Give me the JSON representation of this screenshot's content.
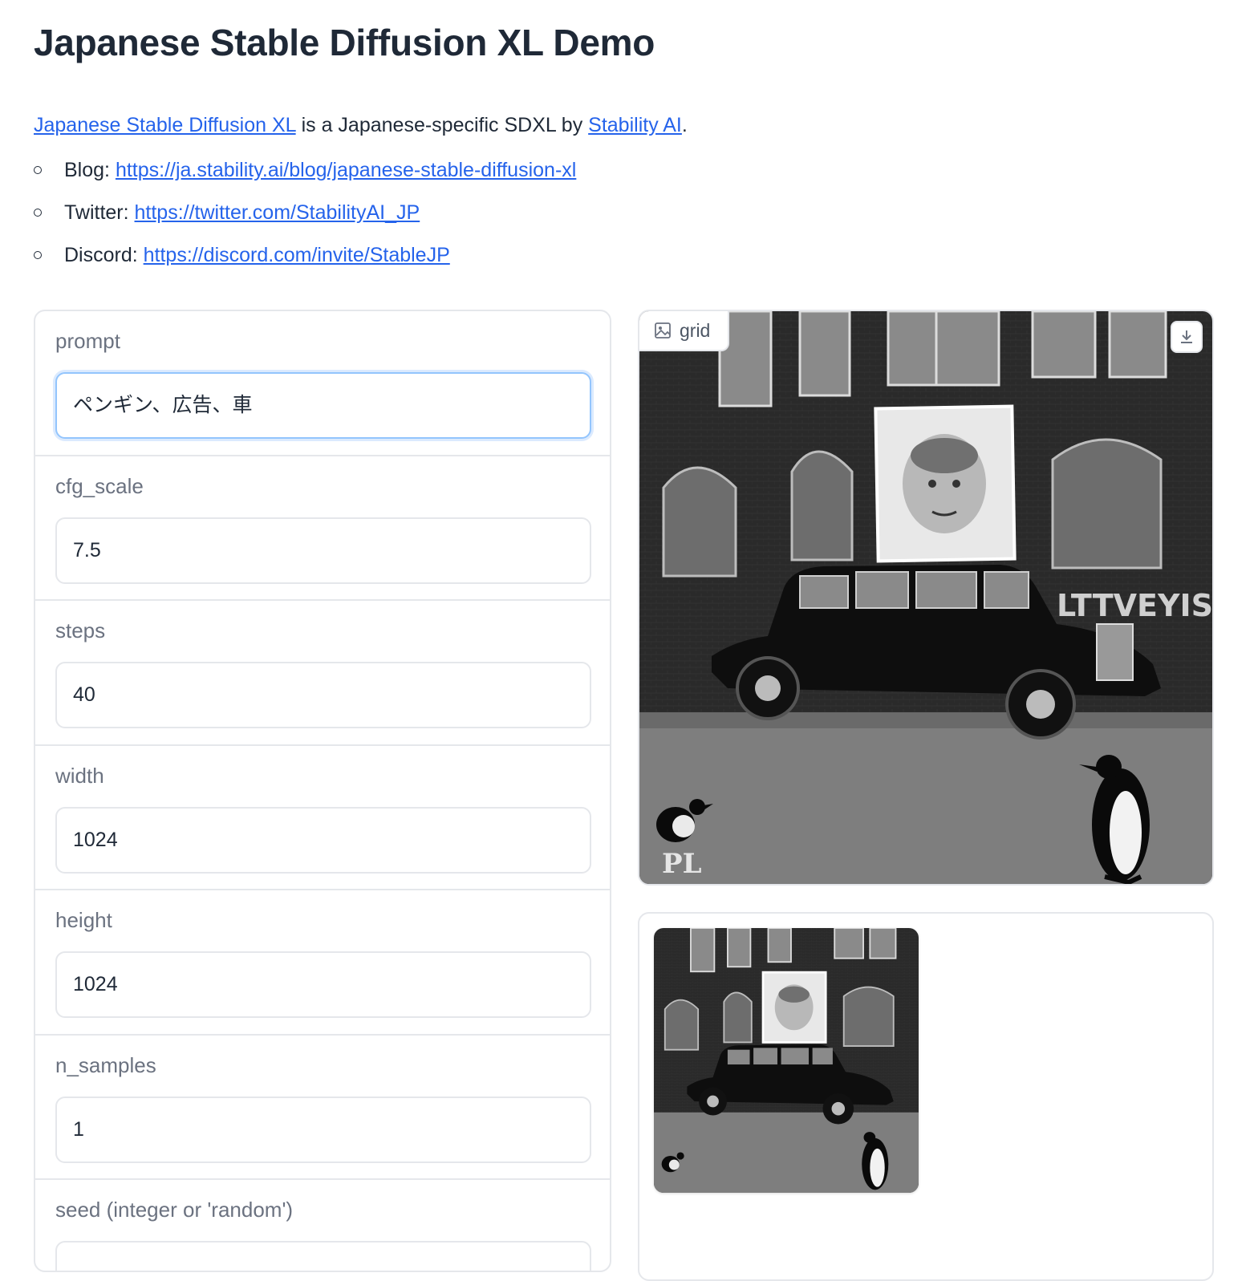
{
  "page": {
    "title": "Japanese Stable Diffusion XL Demo"
  },
  "intro": {
    "model_link": "Japanese Stable Diffusion XL",
    "middle_text": " is a Japanese-specific SDXL by ",
    "org_link": "Stability AI",
    "end_text": "."
  },
  "links": [
    {
      "label": "Blog: ",
      "url_text": "https://ja.stability.ai/blog/japanese-stable-diffusion-xl"
    },
    {
      "label": "Twitter: ",
      "url_text": "https://twitter.com/StabilityAI_JP"
    },
    {
      "label": "Discord: ",
      "url_text": "https://discord.com/invite/StableJP"
    }
  ],
  "fields": {
    "prompt": {
      "label": "prompt",
      "value": "ペンギン、広告、車"
    },
    "cfg_scale": {
      "label": "cfg_scale",
      "value": "7.5"
    },
    "steps": {
      "label": "steps",
      "value": "40"
    },
    "width": {
      "label": "width",
      "value": "1024"
    },
    "height": {
      "label": "height",
      "value": "1024"
    },
    "n_samples": {
      "label": "n_samples",
      "value": "1"
    },
    "seed": {
      "label": "seed (integer or 'random')",
      "value": ""
    }
  },
  "output": {
    "tab_label": "grid",
    "icon": "image-icon",
    "download_icon": "download-icon"
  },
  "image_text": {
    "banner": "LTTVEYIST",
    "watermark": "PL"
  },
  "colors": {
    "link": "#2563eb",
    "focus_border": "#93c5fd",
    "border": "#e5e7eb"
  }
}
